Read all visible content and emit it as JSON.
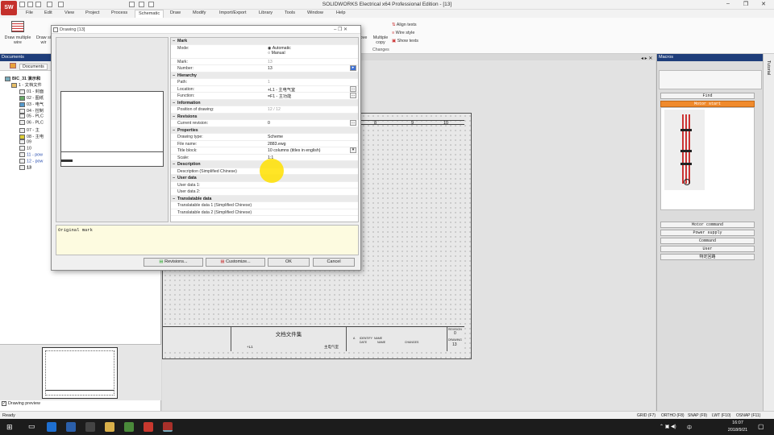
{
  "app": {
    "title": "SOLIDWORKS Electrical x64 Professional Edition - [13]",
    "logo_text": "SW"
  },
  "window_controls": {
    "minimize": "–",
    "restore": "❐",
    "close": "✕"
  },
  "menu": [
    "File",
    "Edit",
    "View",
    "Project",
    "Process",
    "Schematic",
    "Draw",
    "Modify",
    "Import/Export",
    "Library",
    "Tools",
    "Window",
    "Help"
  ],
  "ribbon": {
    "draw_multiple_wire": "Draw multiple wire",
    "draw_si": "Draw si wir",
    "multiple_copy": "Multiple copy",
    "align_texts": "Align texts",
    "wire_style": "Wire style",
    "show_texts": "Show texts",
    "group_changes": "Changes",
    "mo_fragment": "ove"
  },
  "documents_panel": {
    "title": "Documents",
    "tab": "Documents",
    "tree": [
      {
        "label": "BIC_31 演示和",
        "bold": true
      },
      {
        "label": "1 - 文档文件"
      },
      {
        "label": "01 - 封面"
      },
      {
        "label": "02 - 图纸"
      },
      {
        "label": "03 - 电气"
      },
      {
        "label": "04 - 控制"
      },
      {
        "label": "05 - PLC"
      },
      {
        "label": "06 - PLC"
      },
      {
        "label": "07 - 主"
      },
      {
        "label": "08 - 主电"
      },
      {
        "label": "09"
      },
      {
        "label": "10"
      },
      {
        "label": "11 - pow"
      },
      {
        "label": "12 - pow"
      },
      {
        "label": "13",
        "bold": true
      }
    ],
    "preview_checkbox": "Drawing preview"
  },
  "drawing": {
    "columns": [
      "8",
      "9",
      "10"
    ],
    "title_block_title": "文档文件集",
    "tb_location": "+L1",
    "tb_function": "主电气室",
    "revision_label": "REVISION",
    "revision_value": "0",
    "drawing_label": "DRAWING",
    "drawing_value": "13",
    "tb_headers": [
      "DATE",
      "NAME",
      "CHANGES"
    ],
    "tb_sub": [
      "A",
      "IDENTIFY",
      "NAME"
    ]
  },
  "macros_panel": {
    "title": "Macros",
    "top_button": "Find",
    "selected": "Motor start",
    "buttons": [
      "Motor command",
      "Power supply",
      "Command",
      "User",
      "特定回路"
    ]
  },
  "side_strip": {
    "label": "Tutorial"
  },
  "dialog": {
    "title": "Drawing [13]",
    "comment": "Original mark",
    "sections": [
      {
        "name": "Mark",
        "rows": [
          {
            "label": "Mode:",
            "value": "Automatic",
            "value2": "Manual",
            "type": "radio"
          },
          {
            "label": "Mark:",
            "value": "13",
            "dim": true
          },
          {
            "label": "Number:",
            "value": "13",
            "type": "spin"
          }
        ]
      },
      {
        "name": "Hierarchy",
        "rows": [
          {
            "label": "Path:",
            "value": "1",
            "dim": true
          },
          {
            "label": "Location:",
            "value": "+L1 - 主电气室",
            "type": "dots"
          },
          {
            "label": "Function:",
            "value": "=F1 - 主功能",
            "type": "dots"
          }
        ]
      },
      {
        "name": "Information",
        "rows": [
          {
            "label": "Position of drawing:",
            "value": "12 / 12",
            "dim": true
          }
        ]
      },
      {
        "name": "Revisions",
        "rows": [
          {
            "label": "Current revision:",
            "value": "0",
            "type": "dots"
          }
        ]
      },
      {
        "name": "Properties",
        "rows": [
          {
            "label": "Drawing type:",
            "value": "Scheme"
          },
          {
            "label": "File name:",
            "value": "2883.ewg"
          },
          {
            "label": "Title block:",
            "value": "10 columns (titles in english)",
            "type": "combo"
          },
          {
            "label": "Scale:",
            "value": "1:1"
          }
        ]
      },
      {
        "name": "Description",
        "rows": [
          {
            "label": "Description (Simplified Chinese)",
            "value": ""
          }
        ]
      },
      {
        "name": "User data",
        "rows": [
          {
            "label": "User data 1:",
            "value": ""
          },
          {
            "label": "User data 2:",
            "value": ""
          }
        ]
      },
      {
        "name": "Translatable data",
        "rows": [
          {
            "label": "Translatable data 1 (Simplified Chinese)",
            "value": ""
          },
          {
            "label": "Translatable data 2 (Simplified Chinese)",
            "value": ""
          }
        ]
      }
    ],
    "buttons": {
      "revisions": "Revisions...",
      "customize": "Customize...",
      "ok": "OK",
      "cancel": "Cancel"
    }
  },
  "statusbar": {
    "left": "Ready",
    "toggles": [
      "GRID (F7)",
      "ORTHO (F8)",
      "SNAP (F9)",
      "LWT (F10)",
      "OSNAP (F11)"
    ]
  },
  "taskbar": {
    "time": "16:07",
    "date": "2018/9/21",
    "ime": "中"
  },
  "colors": {
    "accent": "#1e3d7a",
    "selected_macro": "#f08a2c",
    "comment_bg": "#fdfbe0",
    "highlight": "#ffe100"
  }
}
